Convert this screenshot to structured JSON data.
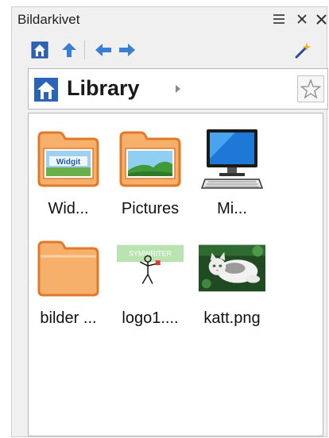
{
  "window": {
    "title": "Bildarkivet"
  },
  "title_buttons": [
    {
      "name": "menu-icon",
      "glyph": "≡"
    },
    {
      "name": "pin-icon",
      "glyph": "✕"
    },
    {
      "name": "close-icon",
      "glyph": "✕"
    }
  ],
  "toolbar": {
    "home_icon": "home-icon",
    "up_icon": "arrow-up-icon",
    "back_icon": "arrow-left-icon",
    "forward_icon": "arrow-right-icon",
    "magic_icon": "magic-wand-icon"
  },
  "address": {
    "crumb": "Library",
    "favorite_icon": "star-icon"
  },
  "items": [
    {
      "label": "Wid...",
      "icon": "folder-widgit-icon"
    },
    {
      "label": "Pictures",
      "icon": "folder-pictures-icon"
    },
    {
      "label": "Mi...",
      "icon": "computer-icon"
    },
    {
      "label": "bilder ...",
      "icon": "folder-icon"
    },
    {
      "label": "logo1....",
      "icon": "logo-image-thumbnail"
    },
    {
      "label": "katt.png",
      "icon": "cat-image-thumbnail"
    }
  ],
  "thumbs": {
    "widgit_text": "Widgit",
    "logo_text": "SYMWRITER"
  },
  "colors": {
    "folder_fill": "#f7b06b",
    "folder_stroke": "#e07a2a",
    "accent_blue": "#2a63b8"
  }
}
